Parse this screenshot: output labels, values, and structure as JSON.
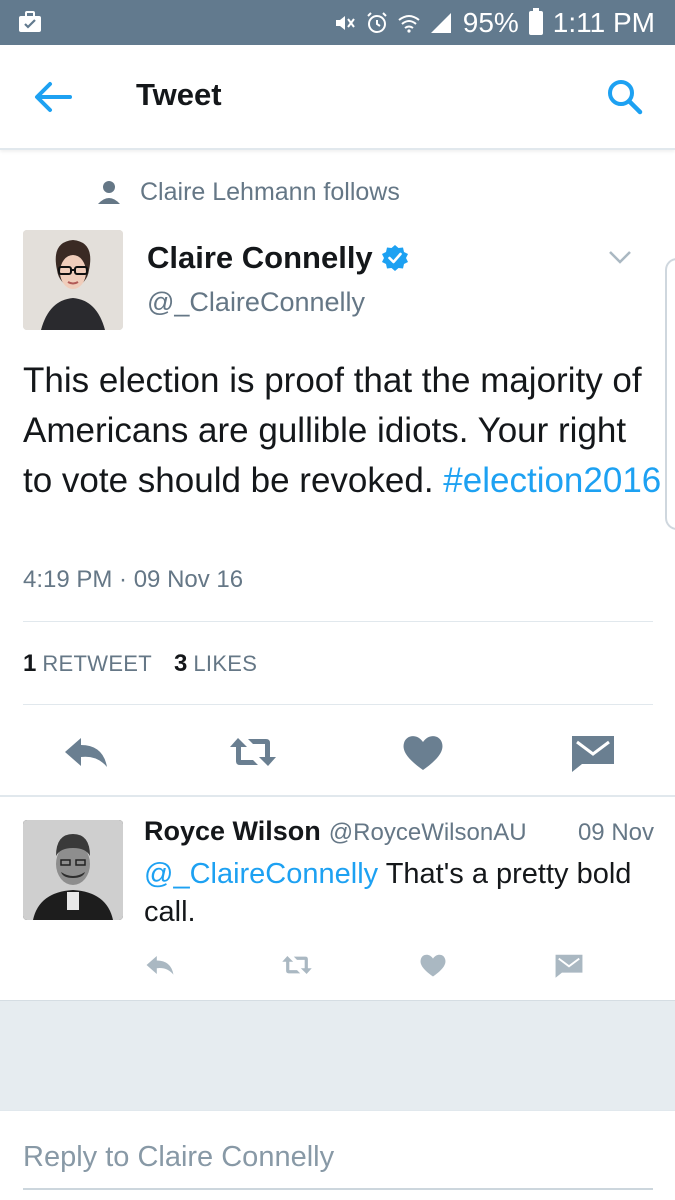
{
  "status_bar": {
    "battery": "95%",
    "time": "1:11 PM",
    "icons": [
      "briefcase-icon",
      "mute-icon",
      "alarm-icon",
      "wifi-icon",
      "signal-icon",
      "battery-icon"
    ]
  },
  "header": {
    "title": "Tweet",
    "back_icon": "arrow-left-icon",
    "search_icon": "search-icon"
  },
  "context": {
    "text": "Claire Lehmann follows",
    "icon": "person-icon"
  },
  "tweet": {
    "author_name": "Claire Connelly",
    "author_handle": "@_ClaireConnelly",
    "verified": true,
    "text": "This election is proof that the majority of Americans are gullible idiots. Your right to vote should be revoked.",
    "hashtag": "#election2016",
    "timestamp": "4:19 PM · 09 Nov 16",
    "retweets": {
      "count": "1",
      "label": "RETWEET"
    },
    "likes": {
      "count": "3",
      "label": "LIKES"
    }
  },
  "reply": {
    "author_name": "Royce Wilson",
    "author_handle": "@RoyceWilsonAU",
    "date": "09 Nov",
    "mention": "@_ClaireConnelly",
    "text": "That's a pretty bold call."
  },
  "composer": {
    "placeholder": "Reply to Claire Connelly"
  },
  "colors": {
    "status_bar": "#627a8e",
    "accent": "#1da1f2",
    "secondary_text": "#657786",
    "icon_gray": "#6a7f91"
  }
}
